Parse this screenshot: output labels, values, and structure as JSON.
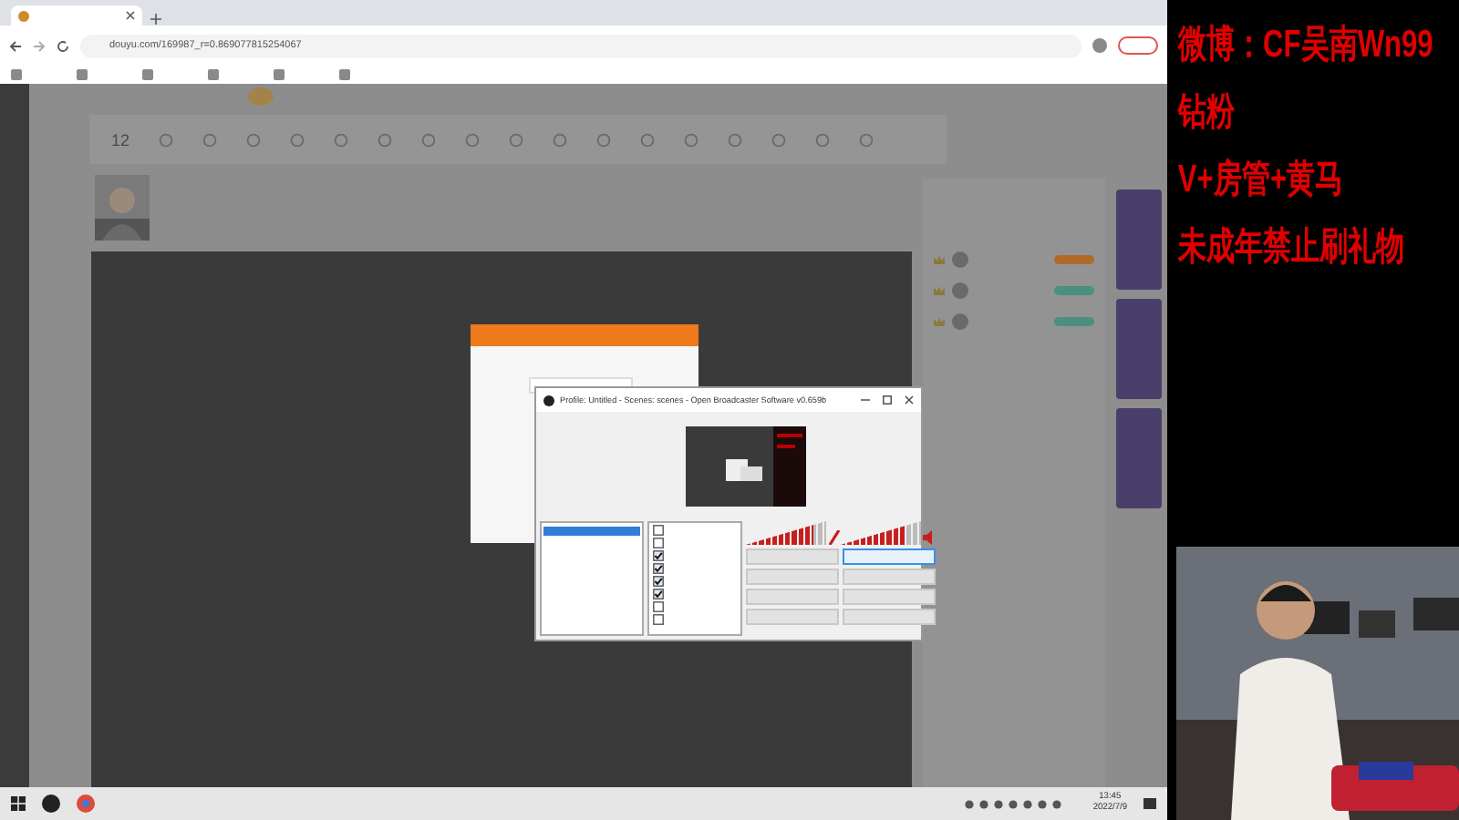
{
  "browser": {
    "url": "douyu.com/169987_r=0.869077815254067",
    "toolbar": {
      "count": "12"
    }
  },
  "obs_window": {
    "title": "Profile: Untitled - Scenes: scenes - Open Broadcaster Software v0.659b",
    "scenes": [
      {
        "selected": true
      }
    ],
    "sources": [
      {
        "checked": false
      },
      {
        "checked": false
      },
      {
        "checked": true
      },
      {
        "checked": true
      },
      {
        "checked": true
      },
      {
        "checked": true
      },
      {
        "checked": false
      },
      {
        "checked": false
      }
    ],
    "meters": [
      {
        "level": 0.85
      },
      {
        "level": 0.8
      }
    ]
  },
  "overlay": {
    "lines": [
      "微博：CF吴南Wn99",
      "钻粉",
      "V+房管+黄马",
      "未成年禁止刷礼物"
    ]
  },
  "taskbar": {
    "time": "13:45",
    "date": "2022/7/9"
  }
}
